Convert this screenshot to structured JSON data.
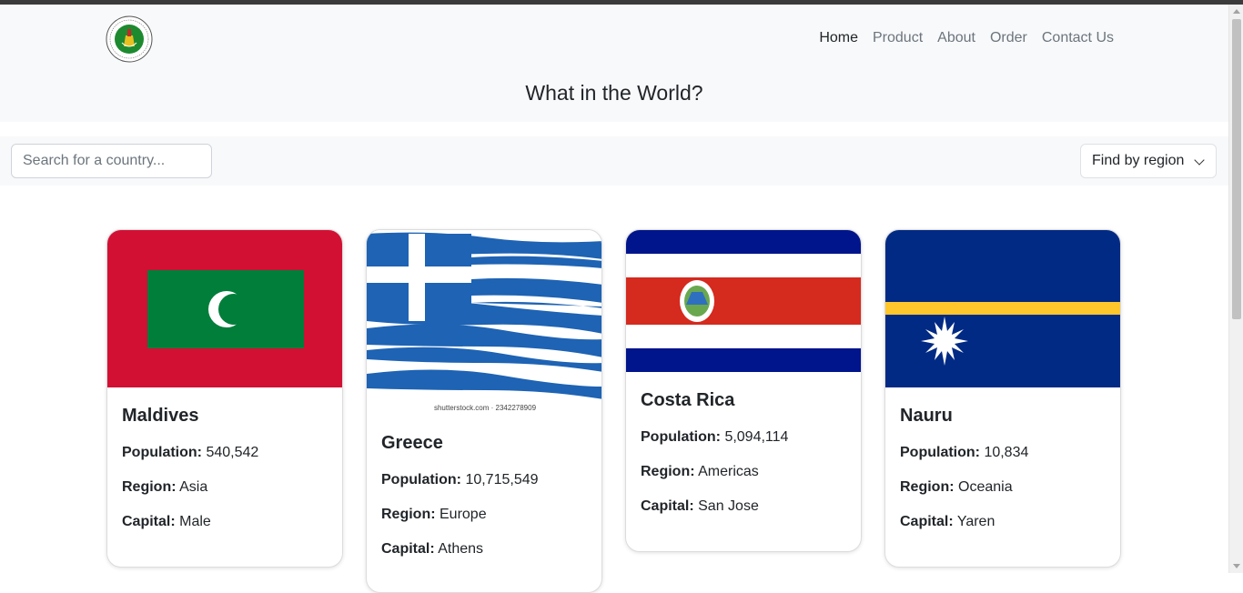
{
  "header": {
    "title": "What in the World?",
    "nav": [
      {
        "label": "Home",
        "active": true
      },
      {
        "label": "Product",
        "active": false
      },
      {
        "label": "About",
        "active": false
      },
      {
        "label": "Order",
        "active": false
      },
      {
        "label": "Contact Us",
        "active": false
      }
    ]
  },
  "toolbar": {
    "search_placeholder": "Search for a country...",
    "search_value": "",
    "region_label": "Find by region"
  },
  "labels": {
    "population": "Population:",
    "region": "Region:",
    "capital": "Capital:"
  },
  "countries": [
    {
      "name": "Maldives",
      "population": "540,542",
      "region": "Asia",
      "capital": "Male"
    },
    {
      "name": "Greece",
      "population": "10,715,549",
      "region": "Europe",
      "capital": "Athens",
      "flag_caption": "shutterstock.com · 2342278909"
    },
    {
      "name": "Costa Rica",
      "population": "5,094,114",
      "region": "Americas",
      "capital": "San Jose"
    },
    {
      "name": "Nauru",
      "population": "10,834",
      "region": "Oceania",
      "capital": "Yaren"
    }
  ],
  "colors": {
    "header_bg": "#f8f9fa",
    "maldives_red": "#d21034",
    "maldives_green": "#007e3a",
    "greece_blue": "#1e63b4",
    "costa_rica_blue": "#00148b",
    "costa_rica_red": "#d52a1e",
    "nauru_blue": "#012a84",
    "nauru_yellow": "#ffc72c"
  }
}
